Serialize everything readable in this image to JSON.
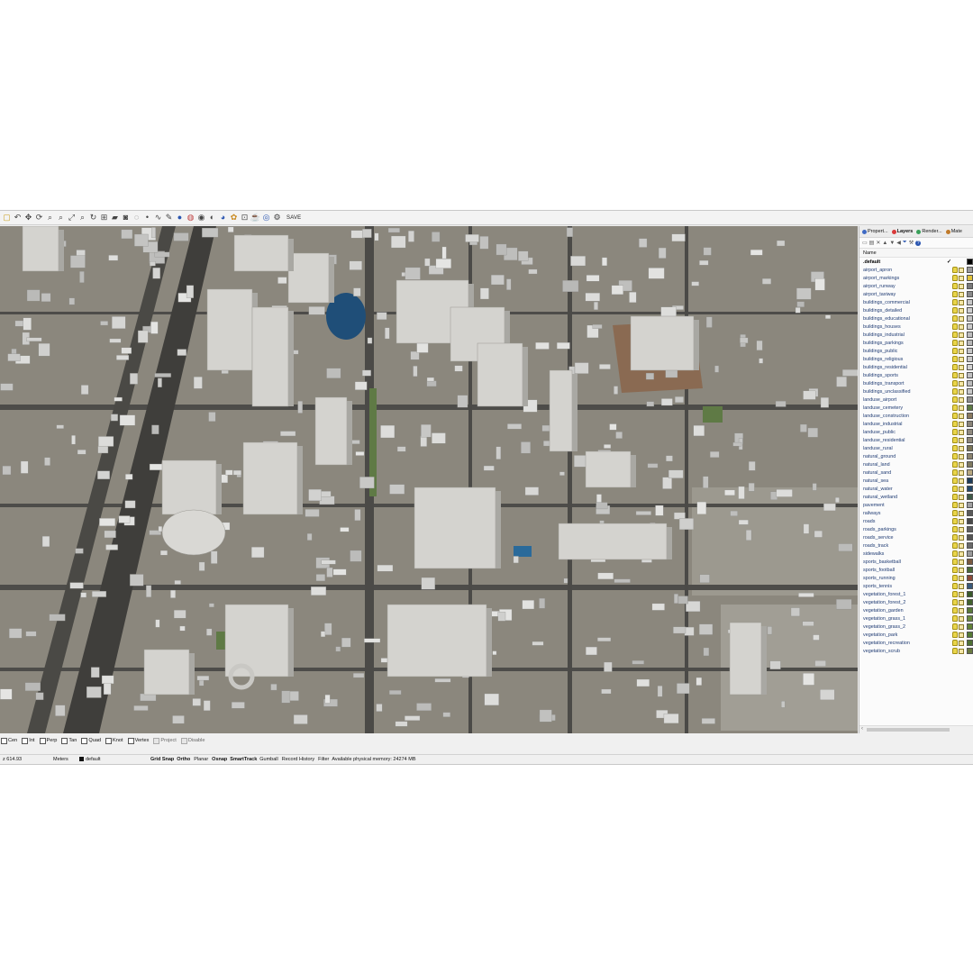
{
  "toolbar": {
    "icons": [
      "new-icon",
      "undo-icon",
      "pan-icon",
      "rotate-icon",
      "zoom-icon",
      "zoom-window-icon",
      "zoom-extents-icon",
      "zoom-selected-icon",
      "rotate-view-icon",
      "four-view-icon",
      "car-icon",
      "camera-icon",
      "lasso-icon",
      "point-icon",
      "curve-icon",
      "brush-icon",
      "sphere-icon",
      "color-wheel-icon",
      "render-icon",
      "material-icon",
      "globe-icon",
      "palette-icon",
      "grid-icon",
      "teapot-icon",
      "earth-icon",
      "gear-icon"
    ],
    "save_label": "SAVE"
  },
  "panel": {
    "tabs": [
      {
        "label": "Propert...",
        "color": "#3f6ac4"
      },
      {
        "label": "Layers",
        "color": "#d93a3a"
      },
      {
        "label": "Render...",
        "color": "#3aa05a"
      },
      {
        "label": "Mate",
        "color": "#c07a2a"
      }
    ],
    "icons": [
      "new-layer-icon",
      "new-sublayer-icon",
      "delete-icon",
      "move-up-icon",
      "move-down-icon",
      "move-left-icon",
      "filter-icon",
      "tools-icon",
      "help-icon"
    ],
    "column_header": "Name",
    "current_check": "✓",
    "layers": [
      {
        "name": ".default",
        "swatch": "#000000",
        "current": true
      },
      {
        "name": "airport_apron",
        "swatch": "#9a9a9a"
      },
      {
        "name": "airport_markings",
        "swatch": "#e0c23a"
      },
      {
        "name": "airport_runway",
        "swatch": "#7a7a7a"
      },
      {
        "name": "airport_taxiway",
        "swatch": "#8a8a8a"
      },
      {
        "name": "buildings_commercial",
        "swatch": "#c8c8c8"
      },
      {
        "name": "buildings_detailed",
        "swatch": "#d0d0d0"
      },
      {
        "name": "buildings_educational",
        "swatch": "#c4c4c4"
      },
      {
        "name": "buildings_houses",
        "swatch": "#cccccc"
      },
      {
        "name": "buildings_industrial",
        "swatch": "#bdbdbd"
      },
      {
        "name": "buildings_parkings",
        "swatch": "#b8b8b8"
      },
      {
        "name": "buildings_public",
        "swatch": "#c6c6c6"
      },
      {
        "name": "buildings_religious",
        "swatch": "#cacaca"
      },
      {
        "name": "buildings_residential",
        "swatch": "#d2d2d2"
      },
      {
        "name": "buildings_sports",
        "swatch": "#c0c0c0"
      },
      {
        "name": "buildings_transport",
        "swatch": "#bcbcbc"
      },
      {
        "name": "buildings_unclassified",
        "swatch": "#c9c9c9"
      },
      {
        "name": "landuse_airport",
        "swatch": "#8f8f8f"
      },
      {
        "name": "landuse_cemetery",
        "swatch": "#5e7a45"
      },
      {
        "name": "landuse_construction",
        "swatch": "#8a7a60"
      },
      {
        "name": "landuse_industrial",
        "swatch": "#8a8478"
      },
      {
        "name": "landuse_public",
        "swatch": "#908a7e"
      },
      {
        "name": "landuse_residential",
        "swatch": "#8e887a"
      },
      {
        "name": "landuse_rural",
        "swatch": "#7a7558"
      },
      {
        "name": "natural_ground",
        "swatch": "#8c8470"
      },
      {
        "name": "natural_land",
        "swatch": "#7f7a60"
      },
      {
        "name": "natural_sand",
        "swatch": "#b8a880"
      },
      {
        "name": "natural_sea",
        "swatch": "#1e3c5a"
      },
      {
        "name": "natural_water",
        "swatch": "#24486a"
      },
      {
        "name": "natural_wetland",
        "swatch": "#3e5a48"
      },
      {
        "name": "pavement",
        "swatch": "#a0a0a0"
      },
      {
        "name": "railways",
        "swatch": "#5a5a5a"
      },
      {
        "name": "roads",
        "swatch": "#4a4a4a"
      },
      {
        "name": "roads_parkings",
        "swatch": "#606060"
      },
      {
        "name": "roads_service",
        "swatch": "#555555"
      },
      {
        "name": "roads_track",
        "swatch": "#6a6a6a"
      },
      {
        "name": "sidewalks",
        "swatch": "#9a9a9a"
      },
      {
        "name": "sports_basketball",
        "swatch": "#7a5a40"
      },
      {
        "name": "sports_football",
        "swatch": "#4a6a3a"
      },
      {
        "name": "sports_running",
        "swatch": "#8a4a3a"
      },
      {
        "name": "sports_tennis",
        "swatch": "#3a5a7a"
      },
      {
        "name": "vegetation_forest_1",
        "swatch": "#3a5a2a"
      },
      {
        "name": "vegetation_forest_2",
        "swatch": "#42622e"
      },
      {
        "name": "vegetation_garden",
        "swatch": "#5a7a3a"
      },
      {
        "name": "vegetation_grass_1",
        "swatch": "#6a8a40"
      },
      {
        "name": "vegetation_grass_2",
        "swatch": "#628238"
      },
      {
        "name": "vegetation_park",
        "swatch": "#557a35"
      },
      {
        "name": "vegetation_recreation",
        "swatch": "#4e7034"
      },
      {
        "name": "vegetation_scrub",
        "swatch": "#6a7a40"
      }
    ]
  },
  "osnap": [
    {
      "label": "Cen",
      "disabled": false
    },
    {
      "label": "Int",
      "disabled": false
    },
    {
      "label": "Perp",
      "disabled": false
    },
    {
      "label": "Tan",
      "disabled": false
    },
    {
      "label": "Quad",
      "disabled": false
    },
    {
      "label": "Knot",
      "disabled": false
    },
    {
      "label": "Vertex",
      "disabled": false
    },
    {
      "label": "Project",
      "disabled": true
    },
    {
      "label": "Disable",
      "disabled": true
    }
  ],
  "statusbar": {
    "z": "z 614.93",
    "units": "Meters",
    "layer": "default",
    "grid_snap": "Grid Snap",
    "ortho": "Ortho",
    "planar": "Planar",
    "osnap": "Osnap",
    "smarttrack": "SmartTrack",
    "gumball": "Gumball",
    "record_history": "Record History",
    "filter": "Filter",
    "memory": "Available physical memory: 24274 MB"
  }
}
